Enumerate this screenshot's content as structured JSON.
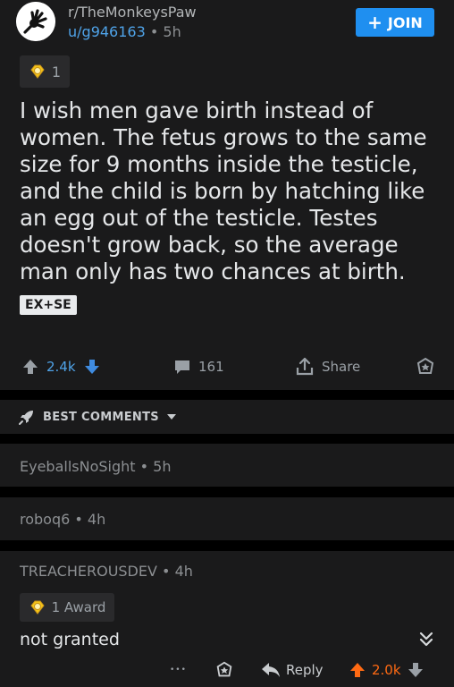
{
  "header": {
    "subreddit": "r/TheMonkeysPaw",
    "username": "u/g946163",
    "age": "5h",
    "separator": "•",
    "join_label": "JOIN"
  },
  "post": {
    "award_count": "1",
    "title": "I wish men gave birth instead of women. The fetus grows to the same size for 9 months inside the testicle, and the child is born by hatching like an egg out of the testicle. Testes doesn't grow back, so the average man only has two chances at birth.",
    "flair": "EX+SE",
    "upvotes": "2.4k",
    "comments": "161",
    "share_label": "Share"
  },
  "sort": {
    "label": "BEST COMMENTS"
  },
  "comments": [
    {
      "author": "EyeballsNoSight",
      "age": "5h"
    },
    {
      "author": "roboq6",
      "age": "4h"
    },
    {
      "author": "TREACHEROUSDEV",
      "age": "4h",
      "award": "1 Award",
      "body": "not granted",
      "more": "•••",
      "reply_label": "Reply",
      "score": "2.0k"
    }
  ],
  "colors": {
    "accent_blue": "#1f8ff0",
    "upvote_orange": "#ff6a13",
    "card_bg": "#1a1a1b",
    "page_bg": "#000000"
  }
}
